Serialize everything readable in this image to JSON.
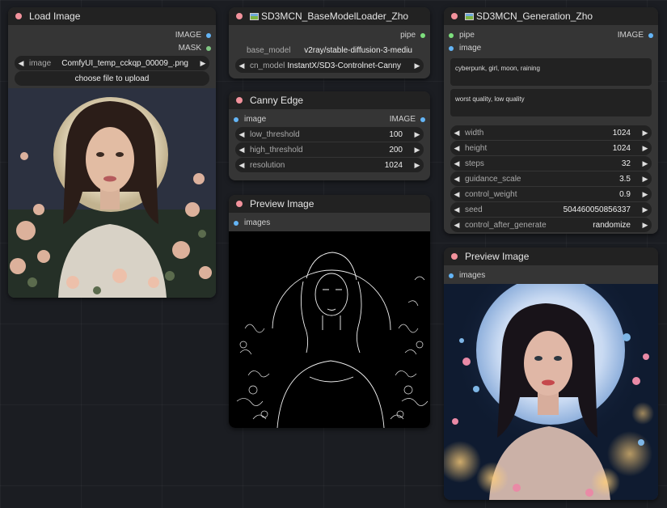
{
  "nodes": {
    "load_image": {
      "title": "Load Image",
      "outputs": [
        "IMAGE",
        "MASK"
      ],
      "image_label": "image",
      "image_value": "ComfyUI_temp_cckqp_00009_.png",
      "upload_label": "choose file to upload"
    },
    "base_loader": {
      "title": "SD3MCN_BaseModelLoader_Zho",
      "output": "pipe",
      "base_model_label": "base_model",
      "base_model_value": "v2ray/stable-diffusion-3-mediu",
      "cn_model_label": "cn_model",
      "cn_model_value": "InstantX/SD3-Controlnet-Canny"
    },
    "canny": {
      "title": "Canny Edge",
      "input": "image",
      "output": "IMAGE",
      "widgets": [
        {
          "label": "low_threshold",
          "value": "100"
        },
        {
          "label": "high_threshold",
          "value": "200"
        },
        {
          "label": "resolution",
          "value": "1024"
        }
      ]
    },
    "preview1": {
      "title": "Preview Image",
      "input": "images"
    },
    "generation": {
      "title": "SD3MCN_Generation_Zho",
      "inputs": [
        "pipe",
        "image"
      ],
      "output": "IMAGE",
      "positive": "cyberpunk, girl, moon, raining",
      "negative": "worst quality, low quality",
      "widgets": [
        {
          "label": "width",
          "value": "1024"
        },
        {
          "label": "height",
          "value": "1024"
        },
        {
          "label": "steps",
          "value": "32"
        },
        {
          "label": "guidance_scale",
          "value": "3.5"
        },
        {
          "label": "control_weight",
          "value": "0.9"
        },
        {
          "label": "seed",
          "value": "504460050856337"
        },
        {
          "label": "control_after_generate",
          "value": "randomize"
        }
      ]
    },
    "preview2": {
      "title": "Preview Image",
      "input": "images"
    }
  },
  "icons": {
    "prev": "◀",
    "next": "▶"
  },
  "colors": {
    "title_dot": "#f2929c",
    "image_socket": "#64b5f6",
    "mask_socket": "#81c784",
    "pipe_socket": "#7ee07e"
  }
}
